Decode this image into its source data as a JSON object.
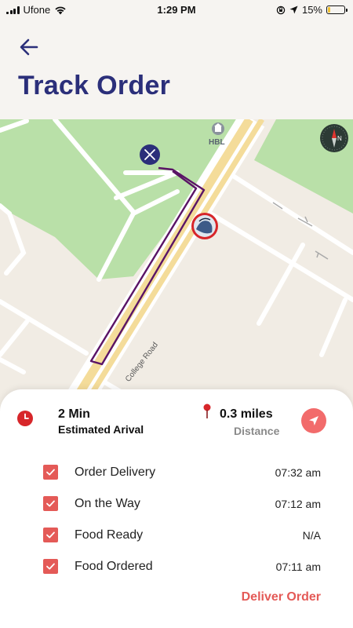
{
  "status_bar": {
    "carrier": "Ufone",
    "time": "1:29 PM",
    "battery_percent": "15%",
    "battery_level": 0.15,
    "icons": [
      "signal-icon",
      "wifi-icon",
      "rotation-lock-icon",
      "location-arrow-icon",
      "battery-icon"
    ]
  },
  "header": {
    "title": "Track Order",
    "back_icon": "back-arrow-icon"
  },
  "map": {
    "poi_label": "HBL",
    "road_label": "College Road",
    "colors": {
      "land": "#f1ece4",
      "park": "#b9e0a8",
      "road": "#ffffff",
      "major_road": "#f4dc9a",
      "route": "#5a1466"
    }
  },
  "summary": {
    "eta_value": "2 Min",
    "eta_label": "Estimated Arival",
    "distance_value": "0.3 miles",
    "distance_label": "Distance"
  },
  "statuses": [
    {
      "name": "Order Delivery",
      "time": "07:32 am",
      "checked": true
    },
    {
      "name": "On the Way",
      "time": "07:12 am",
      "checked": true
    },
    {
      "name": "Food Ready",
      "time": "N/A",
      "checked": true
    },
    {
      "name": "Food Ordered",
      "time": "07:11 am",
      "checked": true
    }
  ],
  "actions": {
    "deliver_label": "Deliver Order"
  },
  "colors": {
    "accent": "#e45a57",
    "title": "#2b2f7a",
    "nav_button": "#f26b6b"
  }
}
